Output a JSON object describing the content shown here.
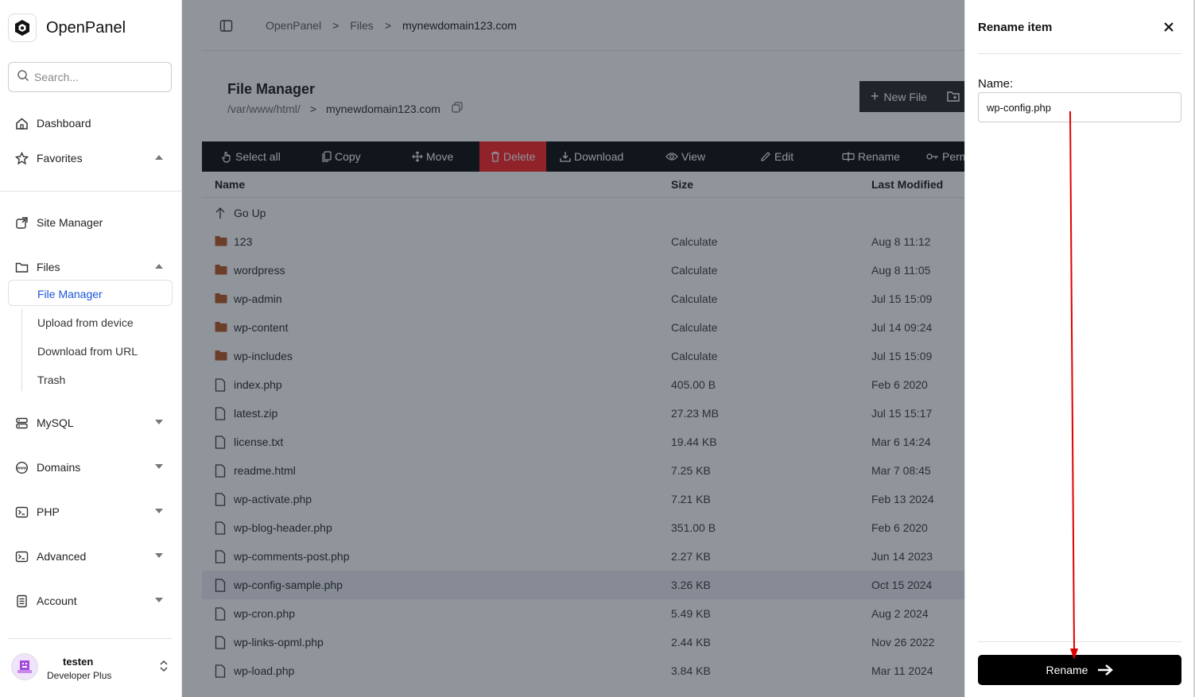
{
  "sidebar": {
    "brand": "OpenPanel",
    "search_placeholder": "Search...",
    "nav": {
      "dashboard": "Dashboard",
      "favorites": "Favorites",
      "site_manager": "Site Manager",
      "files": "Files",
      "mysql": "MySQL",
      "domains": "Domains",
      "php": "PHP",
      "advanced": "Advanced",
      "account": "Account"
    },
    "files_sub": [
      "File Manager",
      "Upload from device",
      "Download from URL",
      "Trash"
    ],
    "user": {
      "name": "testen",
      "plan": "Developer Plus"
    }
  },
  "breadcrumb": [
    "OpenPanel",
    "Files",
    "mynewdomain123.com"
  ],
  "file_manager": {
    "title": "File Manager",
    "path_parent": "/var/www/html/",
    "path_current": "mynewdomain123.com",
    "new_file": "New File",
    "toolbar": {
      "select_all": "Select all",
      "copy": "Copy",
      "move": "Move",
      "delete": "Delete",
      "download": "Download",
      "view": "View",
      "edit": "Edit",
      "rename": "Rename",
      "perm": "Perm"
    },
    "columns": {
      "name": "Name",
      "size": "Size",
      "modified": "Last Modified"
    },
    "go_up": "Go Up",
    "rows": [
      {
        "name": "123",
        "type": "folder",
        "size": "Calculate",
        "modified": "Aug 8 11:12"
      },
      {
        "name": "wordpress",
        "type": "folder",
        "size": "Calculate",
        "modified": "Aug 8 11:05"
      },
      {
        "name": "wp-admin",
        "type": "folder",
        "size": "Calculate",
        "modified": "Jul 15 15:09"
      },
      {
        "name": "wp-content",
        "type": "folder",
        "size": "Calculate",
        "modified": "Jul 14 09:24"
      },
      {
        "name": "wp-includes",
        "type": "folder",
        "size": "Calculate",
        "modified": "Jul 15 15:09"
      },
      {
        "name": "index.php",
        "type": "file",
        "size": "405.00 B",
        "modified": "Feb 6 2020"
      },
      {
        "name": "latest.zip",
        "type": "file",
        "size": "27.23 MB",
        "modified": "Jul 15 15:17"
      },
      {
        "name": "license.txt",
        "type": "file",
        "size": "19.44 KB",
        "modified": "Mar 6 14:24"
      },
      {
        "name": "readme.html",
        "type": "file",
        "size": "7.25 KB",
        "modified": "Mar 7 08:45"
      },
      {
        "name": "wp-activate.php",
        "type": "file",
        "size": "7.21 KB",
        "modified": "Feb 13 2024"
      },
      {
        "name": "wp-blog-header.php",
        "type": "file",
        "size": "351.00 B",
        "modified": "Feb 6 2020"
      },
      {
        "name": "wp-comments-post.php",
        "type": "file",
        "size": "2.27 KB",
        "modified": "Jun 14 2023"
      },
      {
        "name": "wp-config-sample.php",
        "type": "file",
        "size": "3.26 KB",
        "modified": "Oct 15 2024",
        "highlighted": true
      },
      {
        "name": "wp-cron.php",
        "type": "file",
        "size": "5.49 KB",
        "modified": "Aug 2 2024"
      },
      {
        "name": "wp-links-opml.php",
        "type": "file",
        "size": "2.44 KB",
        "modified": "Nov 26 2022"
      },
      {
        "name": "wp-load.php",
        "type": "file",
        "size": "3.84 KB",
        "modified": "Mar 11 2024"
      }
    ]
  },
  "drawer": {
    "title": "Rename item",
    "name_label": "Name:",
    "name_value": "wp-config.php",
    "submit": "Rename"
  },
  "colors": {
    "delete": "#ff1a1a",
    "folder": "#b5521c",
    "annotation_arrow": "#e00000",
    "active_link": "#1a56db"
  }
}
